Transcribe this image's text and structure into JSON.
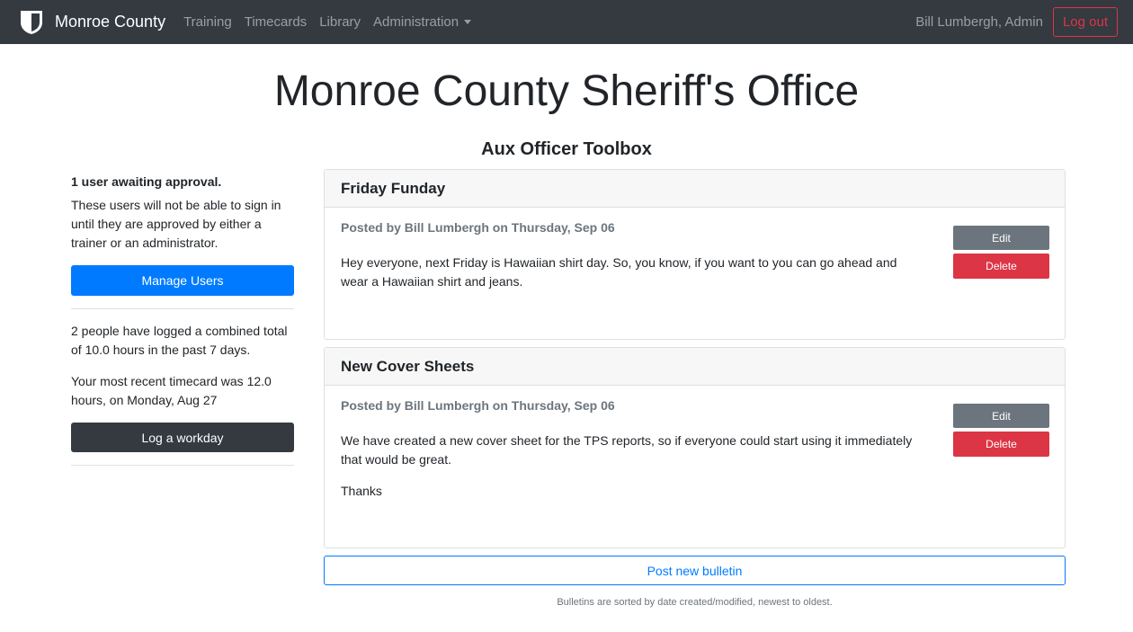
{
  "navbar": {
    "brand": "Monroe County",
    "links": [
      "Training",
      "Timecards",
      "Library",
      "Administration"
    ],
    "user": "Bill Lumbergh, Admin",
    "logout": "Log out"
  },
  "page": {
    "title": "Monroe County Sheriff's Office",
    "subtitle": "Aux Officer Toolbox"
  },
  "sidebar": {
    "approval_title": "1 user awaiting approval.",
    "approval_text": "These users will not be able to sign in until they are approved by either a trainer or an administrator.",
    "manage_users": "Manage Users",
    "hours_text": "2 people have logged a combined total of 10.0 hours in the past 7 days.",
    "recent_text": "Your most recent timecard was 12.0 hours, on Monday, Aug 27",
    "log_workday": "Log a workday"
  },
  "bulletins": [
    {
      "title": "Friday Funday",
      "posted": "Posted by Bill Lumbergh on Thursday, Sep 06",
      "paragraphs": [
        "Hey everyone, next Friday is Hawaiian shirt day. So, you know, if you want to you can go ahead and wear a Hawaiian shirt and jeans."
      ],
      "edit": "Edit",
      "delete": "Delete"
    },
    {
      "title": "New Cover Sheets",
      "posted": "Posted by Bill Lumbergh on Thursday, Sep 06",
      "paragraphs": [
        "We have created a new cover sheet for the TPS reports, so if everyone could start using it immediately that would be great.",
        "Thanks"
      ],
      "edit": "Edit",
      "delete": "Delete"
    }
  ],
  "post_new": "Post new bulletin",
  "footnote": "Bulletins are sorted by date created/modified, newest to oldest."
}
